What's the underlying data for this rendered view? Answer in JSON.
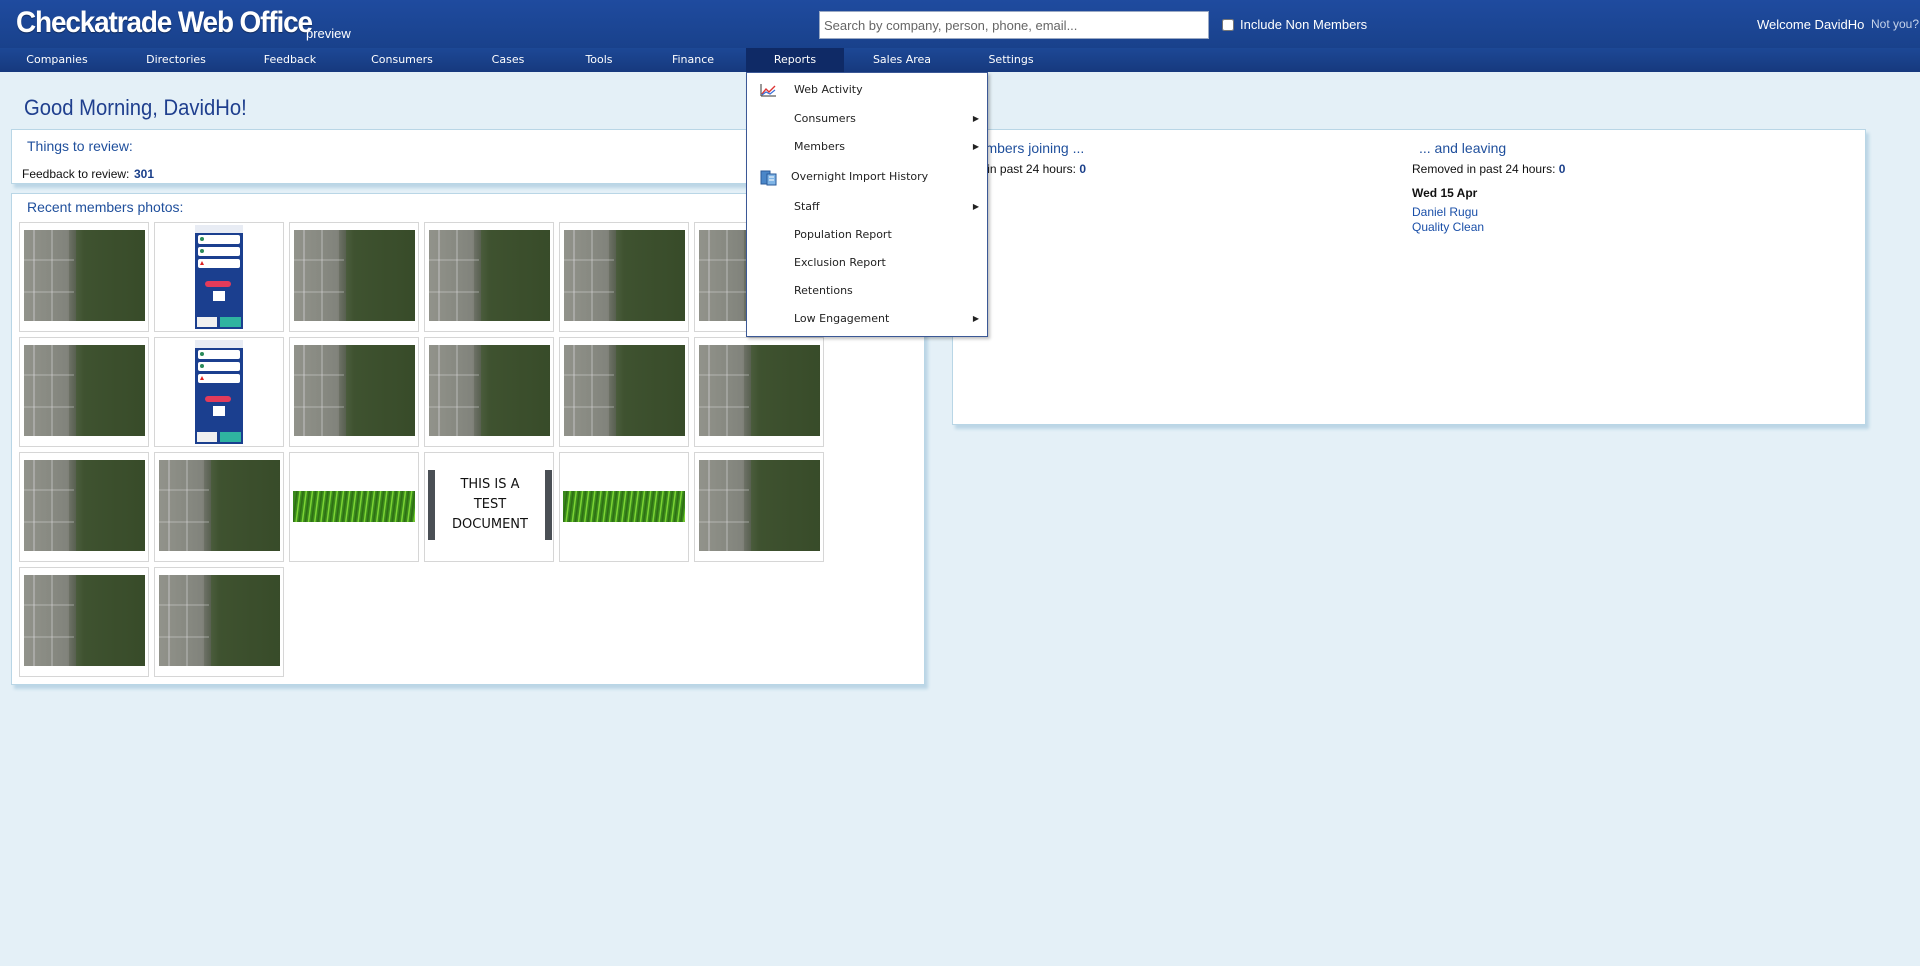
{
  "header": {
    "app_title": "Checkatrade Web Office",
    "env_tag": "preview",
    "search_placeholder": "Search by company, person, phone, email...",
    "include_non_members": "Include Non Members",
    "welcome": "Welcome DavidHo",
    "not_you": "Not you?"
  },
  "nav": {
    "items": [
      "Companies",
      "Directories",
      "Feedback",
      "Consumers",
      "Cases",
      "Tools",
      "Finance",
      "Reports",
      "Sales Area",
      "Settings"
    ],
    "active": "Reports"
  },
  "reports_menu": {
    "items": [
      {
        "label": "Web Activity",
        "icon": "chart-icon",
        "submenu": false
      },
      {
        "label": "Consumers",
        "submenu": true
      },
      {
        "label": "Members",
        "submenu": true
      },
      {
        "label": "Overnight Import History",
        "icon": "database-icon",
        "submenu": false
      },
      {
        "label": "Staff",
        "submenu": true
      },
      {
        "label": "Population Report",
        "submenu": false
      },
      {
        "label": "Exclusion Report",
        "submenu": false
      },
      {
        "label": "Retentions",
        "submenu": false
      },
      {
        "label": "Low Engagement",
        "submenu": true
      }
    ],
    "arrow_glyph": "▶"
  },
  "main": {
    "greeting": "Good Morning, DavidHo!",
    "review": {
      "title": "Things to review:",
      "feedback_label": "Feedback to review:",
      "feedback_count": "301"
    },
    "photos": {
      "title": "Recent members photos:",
      "items": [
        "yard",
        "phone",
        "yard",
        "yard",
        "yard",
        "yard",
        "yard",
        "phone",
        "yard",
        "yard",
        "yard",
        "yard",
        "yard",
        "yard",
        "grass",
        "document",
        "grass",
        "yard",
        "yard",
        "yard"
      ],
      "document_text": [
        "THIS IS A",
        "TEST",
        "DOCUMENT"
      ]
    },
    "joining": {
      "title": "Members joining ...",
      "added_label": "Added in past 24 hours:",
      "added_count": "0"
    },
    "leaving": {
      "title": "... and leaving",
      "removed_label": "Removed in past 24 hours:",
      "removed_count": "0",
      "date": "Wed 15 Apr",
      "names": [
        "Daniel Rugu",
        "Quality Clean"
      ]
    }
  }
}
